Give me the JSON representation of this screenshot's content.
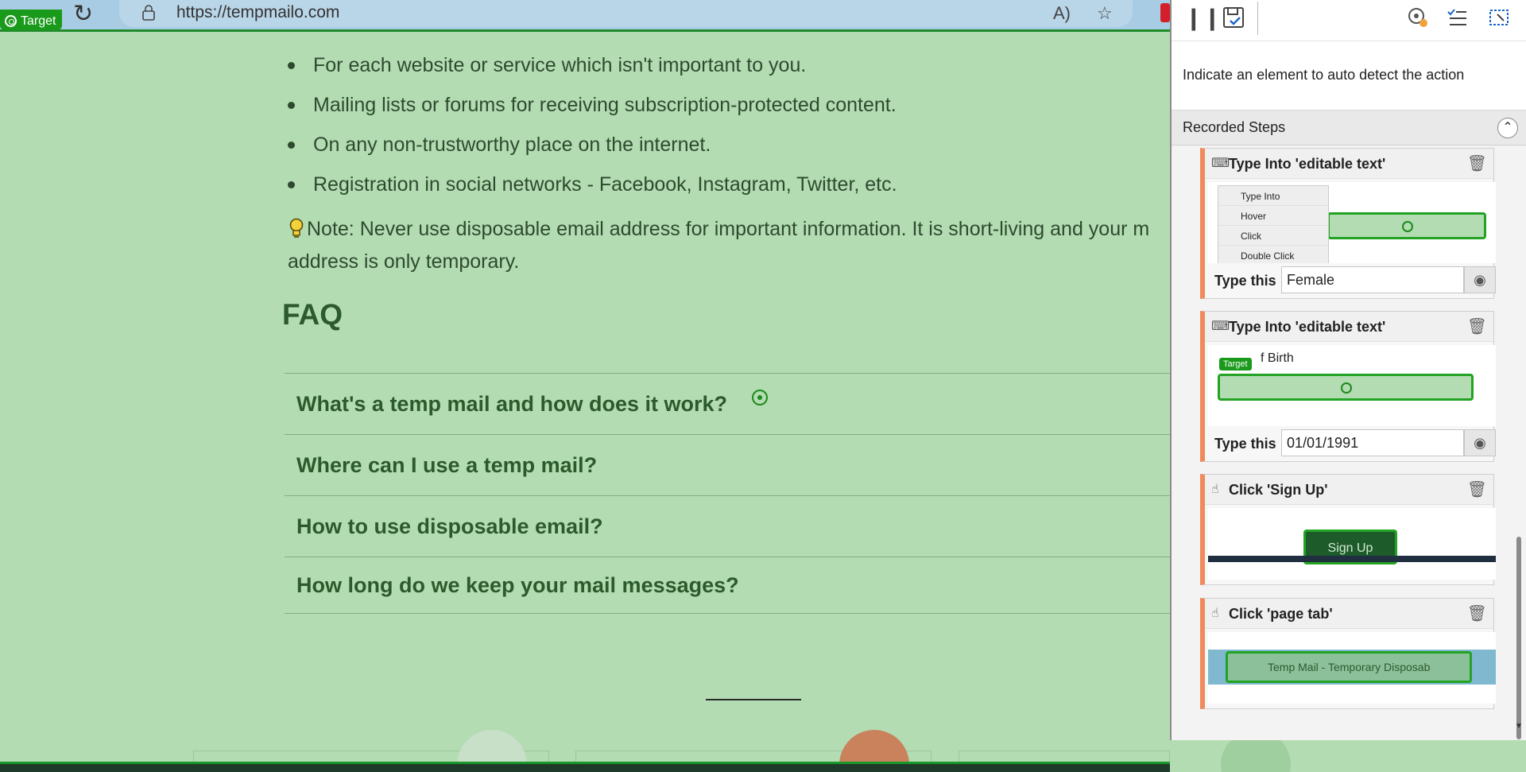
{
  "browser": {
    "url": "https://tempmailo.com",
    "target_label": "Target",
    "read_aloud_icon": "read-aloud-icon",
    "favorites_icon": "add-favorite-icon"
  },
  "page": {
    "bullets": [
      "For each website or service which isn't important to you.",
      "Mailing lists or forums for receiving subscription-protected content.",
      "On any non-trustworthy place on the internet.",
      "Registration in social networks - Facebook, Instagram, Twitter, etc."
    ],
    "note_line1": "Note: Never use disposable email address for important information. It is short-living and your m",
    "note_line2": "address is only temporary.",
    "faq_title": "FAQ",
    "faq_items": [
      "What's a temp mail and how does it work?",
      "Where can I use a temp mail?",
      "How to use disposable email?",
      "How long do we keep your mail messages?"
    ]
  },
  "recorder": {
    "hint": "Indicate an element to auto detect the action",
    "steps_title": "Recorded Steps",
    "steps": [
      {
        "title": "Type Into 'editable text'",
        "type_label": "Type this",
        "type_value": "Female",
        "menu": [
          "Type Into",
          "Hover",
          "Click",
          "Double Click"
        ]
      },
      {
        "title": "Type Into 'editable text'",
        "type_label": "Type this",
        "type_value": "01/01/1991",
        "preview_text": "f Birth",
        "preview_target": "Target"
      },
      {
        "title": "Click 'Sign Up'",
        "preview_button": "Sign Up"
      },
      {
        "title": "Click 'page tab'",
        "preview_tab": "Temp Mail - Temporary Disposab"
      }
    ]
  },
  "colors": {
    "page_bg": "#b3dcb3",
    "accent_green": "#1a9a1a",
    "step_border": "#f08a5c",
    "faq_text": "#2d5a2d"
  }
}
